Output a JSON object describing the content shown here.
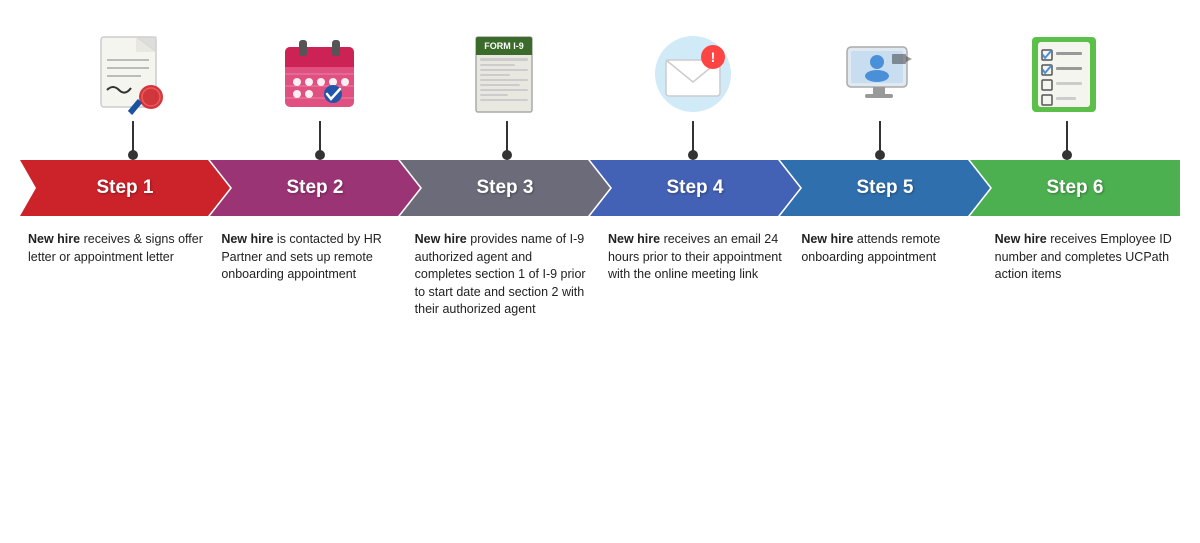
{
  "steps": [
    {
      "id": "step-1",
      "label": "Step 1",
      "color": "#cc2229",
      "icon": "offer-letter",
      "description_bold": "New hire",
      "description_rest": " receives & signs offer letter or appointment letter"
    },
    {
      "id": "step-2",
      "label": "Step 2",
      "color": "#9b3475",
      "icon": "calendar",
      "description_bold": "New hire",
      "description_rest": " is contacted by HR Partner and sets up remote onboarding appointment"
    },
    {
      "id": "step-3",
      "label": "Step 3",
      "color": "#6b6b7a",
      "icon": "form-i9",
      "description_bold": "New hire",
      "description_rest": " provides name of I-9 authorized agent and completes section 1 of I-9 prior to start date and section 2 with their authorized agent"
    },
    {
      "id": "step-4",
      "label": "Step 4",
      "color": "#4361b5",
      "icon": "email",
      "description_bold": "New hire",
      "description_rest": " receives an email 24 hours prior to their appointment with the online meeting link"
    },
    {
      "id": "step-5",
      "label": "Step 5",
      "color": "#2f6fad",
      "icon": "video-call",
      "description_bold": "New hire",
      "description_rest": " attends remote onboarding appointment"
    },
    {
      "id": "step-6",
      "label": "Step 6",
      "color": "#4caf50",
      "icon": "checklist",
      "description_bold": "New hire",
      "description_rest": " receives Employee ID number and completes UCPath action items"
    }
  ]
}
